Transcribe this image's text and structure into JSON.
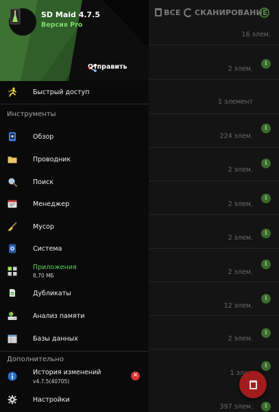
{
  "toolbar": {
    "delete_all": "ВСЕ",
    "scan": "СКАНИРОВАНИЕ"
  },
  "background_rows": [
    {
      "count": "16 элем."
    },
    {
      "count": "2 элем."
    },
    {
      "count": "1 элемент"
    },
    {
      "count": "224 элем."
    },
    {
      "count": "2 элем."
    },
    {
      "count": "2 элем."
    },
    {
      "count": "2 элем."
    },
    {
      "count": "2 элем."
    },
    {
      "count": "12 элем."
    },
    {
      "count": "2 элем."
    },
    {
      "count": "1 элем"
    },
    {
      "count": "397 элем."
    }
  ],
  "drawer": {
    "app_name": "SD Maid 4.7.5",
    "app_edition": "Версия Pro",
    "share_label": "Отправить",
    "quick_access": "Быстрый доступ",
    "tools_header": "Инструменты",
    "tools": {
      "overview": "Обзор",
      "explorer": "Проводник",
      "search": "Поиск",
      "manager": "Менеджер",
      "junk": "Мусор",
      "system": "Система",
      "apps": "Приложения",
      "apps_size": "8,70 МБ",
      "duplicates": "Дубликаты",
      "storage_analysis": "Анализ памяти",
      "databases": "Базы данных"
    },
    "extra_header": "Дополнительно",
    "changelog": "История изменений",
    "changelog_version": "v4.7.5(40705)",
    "settings": "Настройки"
  },
  "colors": {
    "accent_green": "#5cd05a",
    "header_green": "#203f1c",
    "fab_red": "#a11d1d",
    "close_red": "#d93434"
  }
}
